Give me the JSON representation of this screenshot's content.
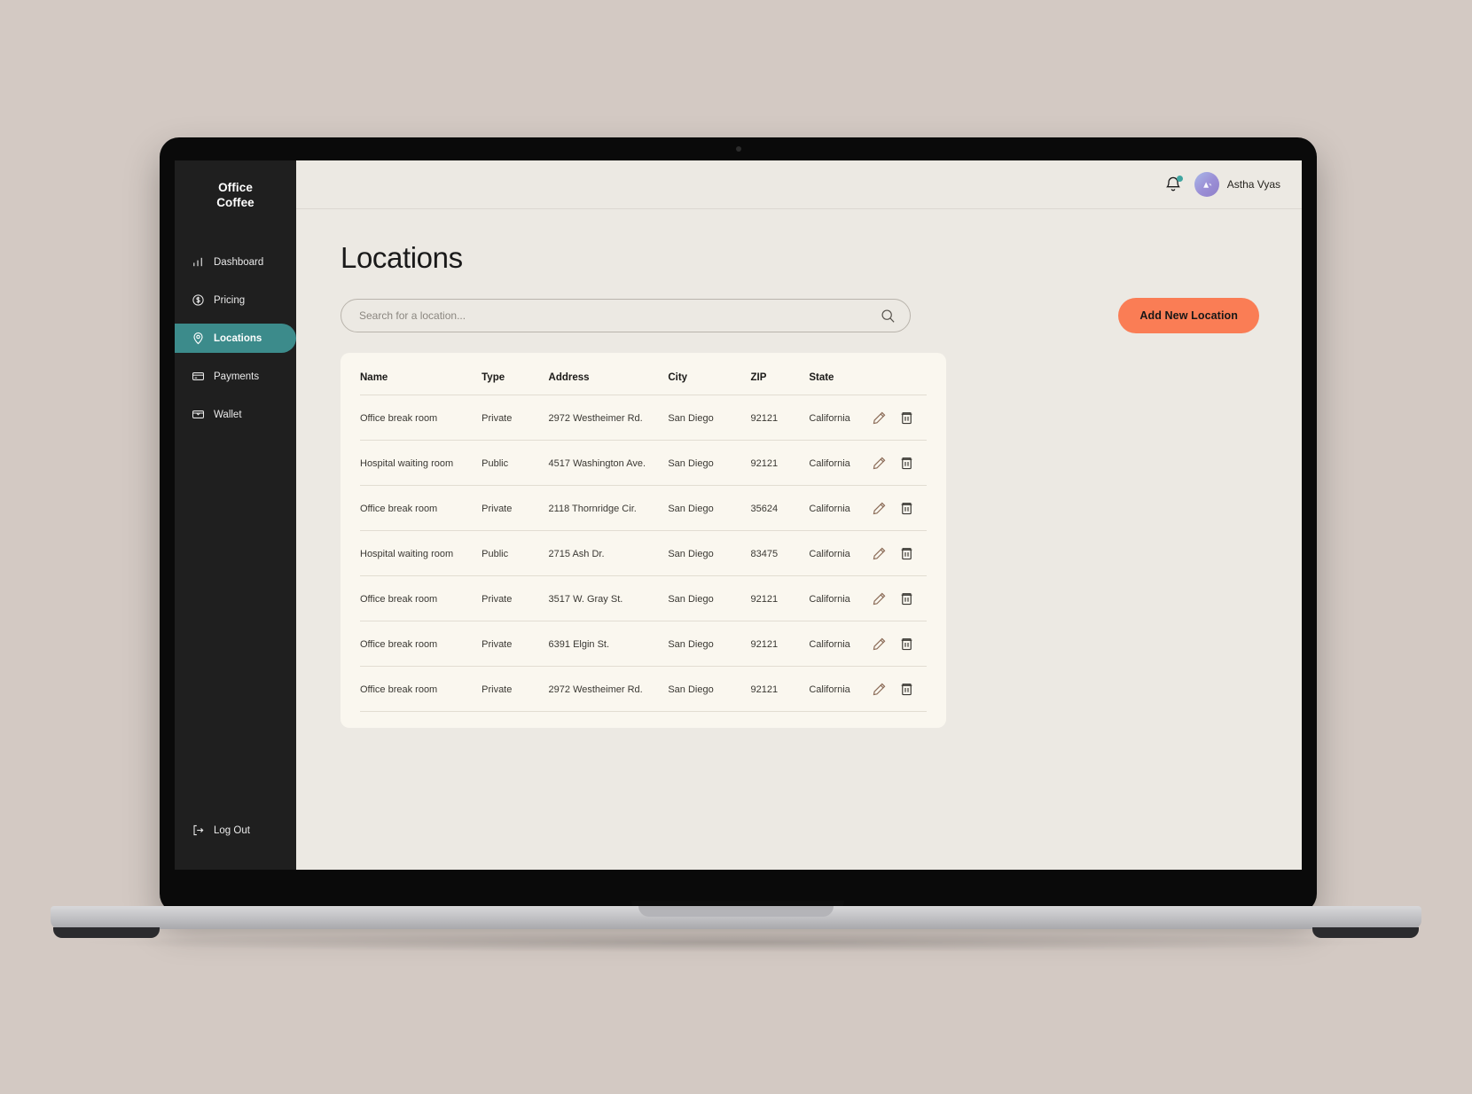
{
  "brand": {
    "line1": "Office",
    "line2": "Coffee"
  },
  "sidebar": {
    "items": [
      {
        "label": "Dashboard",
        "icon": "bar-chart-icon",
        "active": false
      },
      {
        "label": "Pricing",
        "icon": "dollar-circle-icon",
        "active": false
      },
      {
        "label": "Locations",
        "icon": "map-pin-icon",
        "active": true
      },
      {
        "label": "Payments",
        "icon": "credit-card-icon",
        "active": false
      },
      {
        "label": "Wallet",
        "icon": "wallet-icon",
        "active": false
      }
    ],
    "logout_label": "Log Out",
    "logout_icon": "logout-icon",
    "active_color": "#3C8B8B",
    "background": "#1F1F1F"
  },
  "topbar": {
    "notification_icon": "bell-icon",
    "has_unread": true,
    "unread_dot_color": "#3FA5A0",
    "user_name": "Astha Vyas",
    "avatar_icon": "user-avatar"
  },
  "page": {
    "title": "Locations"
  },
  "search": {
    "placeholder": "Search for a location...",
    "value": "",
    "icon": "search-icon"
  },
  "add_button": {
    "label": "Add New Location",
    "color": "#FA7D55"
  },
  "table": {
    "columns": [
      "Name",
      "Type",
      "Address",
      "City",
      "ZIP",
      "State"
    ],
    "row_actions": [
      {
        "icon": "edit-pencil-icon",
        "color": "#8A6A56"
      },
      {
        "icon": "trash-icon",
        "color": "#3A3833"
      }
    ],
    "rows": [
      {
        "name": "Office break room",
        "type": "Private",
        "address": "2972 Westheimer Rd.",
        "city": "San Diego",
        "zip": "92121",
        "state": "California"
      },
      {
        "name": "Hospital waiting room",
        "type": "Public",
        "address": "4517 Washington Ave.",
        "city": "San Diego",
        "zip": "92121",
        "state": "California"
      },
      {
        "name": "Office break room",
        "type": "Private",
        "address": "2118 Thornridge Cir.",
        "city": "San Diego",
        "zip": "35624",
        "state": "California"
      },
      {
        "name": "Hospital waiting room",
        "type": "Public",
        "address": "2715 Ash Dr.",
        "city": "San Diego",
        "zip": "83475",
        "state": "California"
      },
      {
        "name": "Office break room",
        "type": "Private",
        "address": "3517 W. Gray St.",
        "city": "San Diego",
        "zip": "92121",
        "state": "California"
      },
      {
        "name": "Office break room",
        "type": "Private",
        "address": "6391 Elgin St.",
        "city": "San Diego",
        "zip": "92121",
        "state": "California"
      },
      {
        "name": "Office break room",
        "type": "Private",
        "address": "2972 Westheimer Rd.",
        "city": "San Diego",
        "zip": "92121",
        "state": "California"
      }
    ]
  }
}
